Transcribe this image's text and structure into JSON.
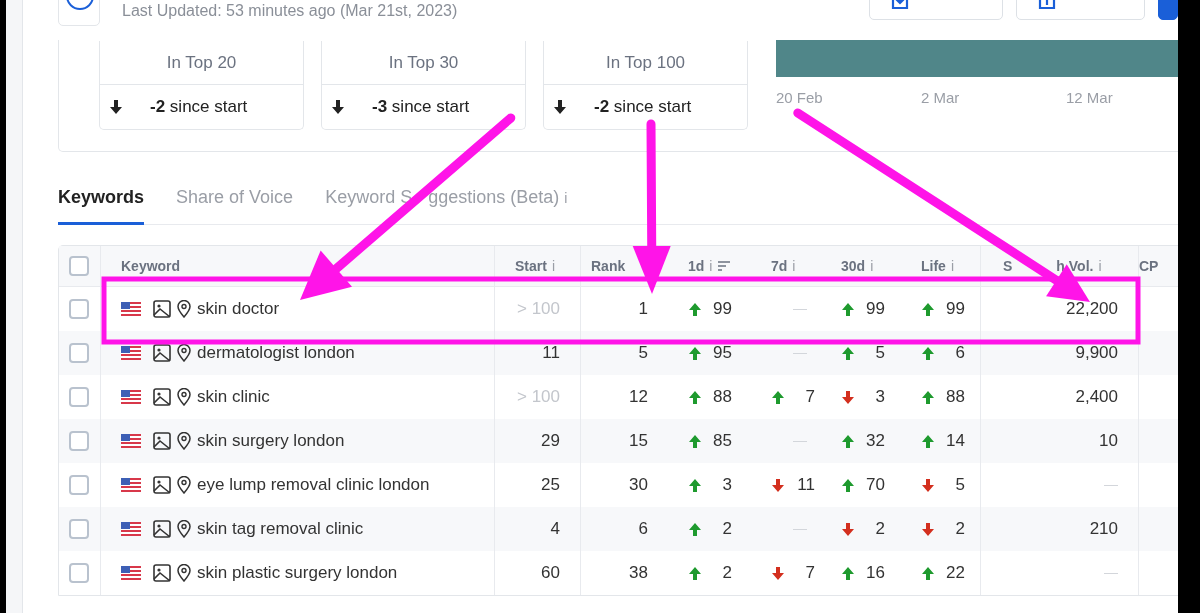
{
  "header": {
    "last_updated": "Last Updated: 53 minutes ago (Mar 21st, 2023)",
    "buttons": [
      {
        "kind": "export"
      },
      {
        "kind": "share"
      }
    ]
  },
  "summary_cards": [
    {
      "label": "In Top 20",
      "change": "**-2** since start",
      "kind": "down"
    },
    {
      "label": "In Top 30",
      "change": "**-3** since start",
      "kind": "down"
    },
    {
      "label": "In Top 100",
      "change": "**-2** since start",
      "kind": "down"
    }
  ],
  "timeline": {
    "ticks": [
      "20 Feb",
      "2 Mar",
      "12 Mar"
    ]
  },
  "tabs": [
    {
      "label_parts": [
        "Keywords"
      ],
      "selected": true
    },
    {
      "label_parts": [
        "Share of Voice"
      ],
      "selected": false
    },
    {
      "label_parts": [
        "Keyword S",
        "ggestions (Beta)"
      ],
      "selected": false,
      "info": "i"
    }
  ],
  "table": {
    "select_all": {
      "checked": false
    },
    "columns": [
      {
        "label_parts": [
          "Keyword"
        ]
      },
      {
        "label_parts": [
          "Start"
        ],
        "info": "i"
      },
      {
        "label_parts": [
          "Rank"
        ]
      },
      {
        "label_parts": [
          "1d"
        ],
        "info": "i",
        "sort": true
      },
      {
        "label_parts": [
          "7d"
        ],
        "info": "i"
      },
      {
        "label_parts": [
          "30d"
        ],
        "info": "i"
      },
      {
        "label_parts": [
          "Life"
        ],
        "info": "i"
      },
      {
        "label_parts": [
          "S",
          "h Vol."
        ],
        "info": "i"
      },
      {
        "label_parts": [
          "CP"
        ]
      }
    ],
    "rows": [
      {
        "checked": false,
        "keyword": "skin doctor",
        "start": {
          "text": "> 100",
          "muted": true
        },
        "rank": "1",
        "changes": [
          {
            "kind": "up",
            "value": "99"
          },
          {
            "kind": "none"
          },
          {
            "kind": "up",
            "value": "99"
          },
          {
            "kind": "up",
            "value": "99"
          }
        ],
        "search_vol": {
          "kind": "value",
          "text": "22,200"
        }
      },
      {
        "checked": false,
        "keyword": "dermatologist london",
        "start": {
          "text": "11",
          "muted": false
        },
        "rank": "5",
        "changes": [
          {
            "kind": "up",
            "value": "95"
          },
          {
            "kind": "none"
          },
          {
            "kind": "up",
            "value": "5"
          },
          {
            "kind": "up",
            "value": "6"
          }
        ],
        "search_vol": {
          "kind": "value",
          "text": "9,900"
        }
      },
      {
        "checked": false,
        "keyword": "skin clinic",
        "start": {
          "text": "> 100",
          "muted": true
        },
        "rank": "12",
        "changes": [
          {
            "kind": "up",
            "value": "88"
          },
          {
            "kind": "up",
            "value": "7"
          },
          {
            "kind": "down",
            "value": "3"
          },
          {
            "kind": "up",
            "value": "88"
          }
        ],
        "search_vol": {
          "kind": "value",
          "text": "2,400"
        }
      },
      {
        "checked": false,
        "keyword": "skin surgery london",
        "start": {
          "text": "29",
          "muted": false
        },
        "rank": "15",
        "changes": [
          {
            "kind": "up",
            "value": "85"
          },
          {
            "kind": "none"
          },
          {
            "kind": "up",
            "value": "32"
          },
          {
            "kind": "up",
            "value": "14"
          }
        ],
        "search_vol": {
          "kind": "value",
          "text": "10"
        }
      },
      {
        "checked": false,
        "keyword": "eye lump removal clinic london",
        "start": {
          "text": "25",
          "muted": false
        },
        "rank": "30",
        "changes": [
          {
            "kind": "up",
            "value": "3"
          },
          {
            "kind": "down",
            "value": "11"
          },
          {
            "kind": "up",
            "value": "70"
          },
          {
            "kind": "down",
            "value": "5"
          }
        ],
        "search_vol": {
          "kind": "none"
        }
      },
      {
        "checked": false,
        "keyword": "skin tag removal clinic",
        "start": {
          "text": "4",
          "muted": false
        },
        "rank": "6",
        "changes": [
          {
            "kind": "up",
            "value": "2"
          },
          {
            "kind": "none"
          },
          {
            "kind": "down",
            "value": "2"
          },
          {
            "kind": "down",
            "value": "2"
          }
        ],
        "search_vol": {
          "kind": "value",
          "text": "210"
        }
      },
      {
        "checked": false,
        "keyword": "skin plastic surgery london",
        "start": {
          "text": "60",
          "muted": false
        },
        "rank": "38",
        "changes": [
          {
            "kind": "up",
            "value": "2"
          },
          {
            "kind": "down",
            "value": "7"
          },
          {
            "kind": "up",
            "value": "16"
          },
          {
            "kind": "up",
            "value": "22"
          }
        ],
        "search_vol": {
          "kind": "none"
        }
      }
    ]
  }
}
